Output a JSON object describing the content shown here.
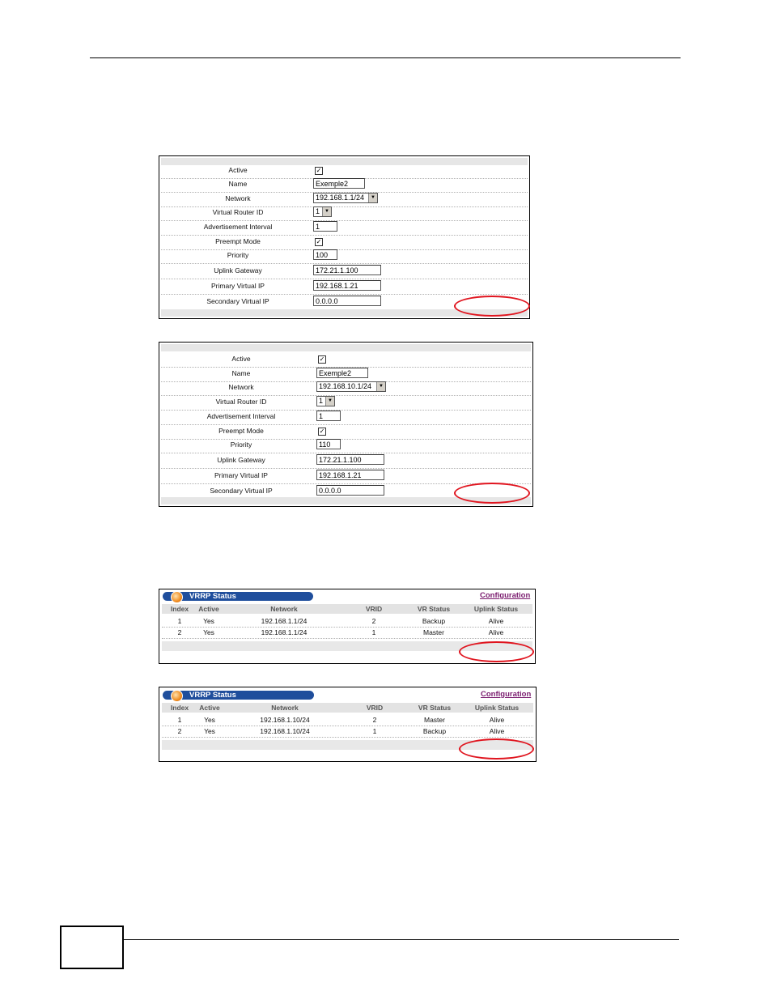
{
  "form_fields": [
    {
      "key": "active",
      "label": "Active"
    },
    {
      "key": "name",
      "label": "Name"
    },
    {
      "key": "network",
      "label": "Network"
    },
    {
      "key": "vrid",
      "label": "Virtual Router ID"
    },
    {
      "key": "adv",
      "label": "Advertisement Interval"
    },
    {
      "key": "preempt",
      "label": "Preempt Mode"
    },
    {
      "key": "priority",
      "label": "Priority"
    },
    {
      "key": "uplink",
      "label": "Uplink Gateway"
    },
    {
      "key": "primary",
      "label": "Primary Virtual IP"
    },
    {
      "key": "secondary",
      "label": "Secondary Virtual IP"
    }
  ],
  "form1": {
    "active_checked": "✓",
    "name": "Exemple2",
    "network": "192.168.1.1/24",
    "vrid": "1",
    "adv": "1",
    "preempt_checked": "✓",
    "priority": "100",
    "uplink": "172.21.1.100",
    "primary": "192.168.1.21",
    "secondary": "0.0.0.0"
  },
  "form2": {
    "active_checked": "✓",
    "name": "Exemple2",
    "network": "192.168.10.1/24",
    "vrid": "1",
    "adv": "1",
    "preempt_checked": "✓",
    "priority": "110",
    "uplink": "172.21.1.100",
    "primary": "192.168.1.21",
    "secondary": "0.0.0.0"
  },
  "status_title": "VRRP Status",
  "configuration_link": "Configuration",
  "status_columns": [
    "Index",
    "Active",
    "Network",
    "VRID",
    "VR Status",
    "Uplink Status"
  ],
  "status1": {
    "rows": [
      [
        "1",
        "Yes",
        "192.168.1.1/24",
        "2",
        "Backup",
        "Alive"
      ],
      [
        "2",
        "Yes",
        "192.168.1.1/24",
        "1",
        "Master",
        "Alive"
      ]
    ]
  },
  "status2": {
    "rows": [
      [
        "1",
        "Yes",
        "192.168.1.10/24",
        "2",
        "Master",
        "Alive"
      ],
      [
        "2",
        "Yes",
        "192.168.1.10/24",
        "1",
        "Backup",
        "Alive"
      ]
    ]
  },
  "colors": {
    "highlight_ellipse": "#e0151f",
    "title_bar": "#1f4e9c",
    "config_link": "#7a1b6e"
  }
}
